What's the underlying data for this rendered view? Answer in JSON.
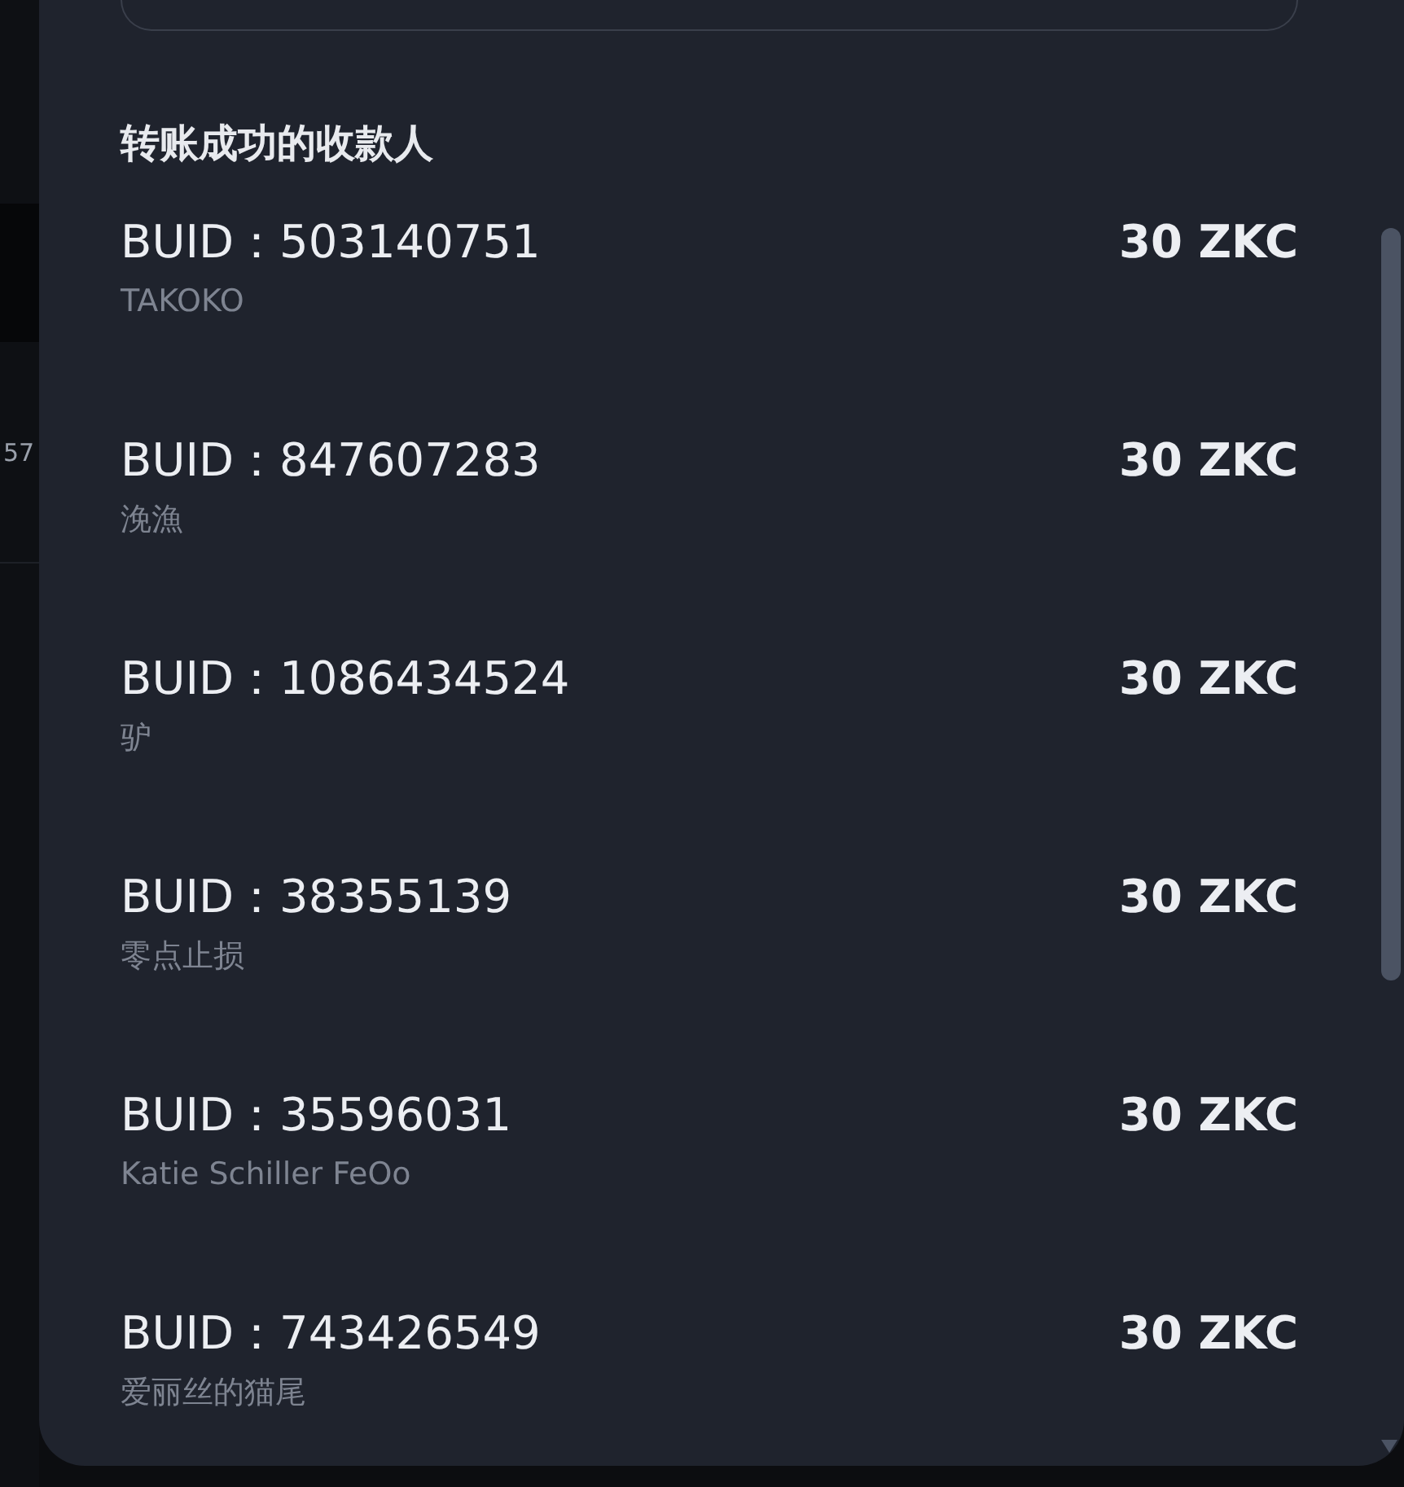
{
  "background_page": {
    "row_value": "57"
  },
  "panel": {
    "title": "转账成功的收款人",
    "recipients": [
      {
        "buid": "BUID：503140751",
        "name": "TAKOKO",
        "amount": "30 ZKC"
      },
      {
        "buid": "BUID：847607283",
        "name": "浼漁",
        "amount": "30 ZKC"
      },
      {
        "buid": "BUID：1086434524",
        "name": "驴",
        "amount": "30 ZKC"
      },
      {
        "buid": "BUID：38355139",
        "name": "零点止损",
        "amount": "30 ZKC"
      },
      {
        "buid": "BUID：35596031",
        "name": "Katie Schiller FeOo",
        "amount": "30 ZKC"
      },
      {
        "buid": "BUID：743426549",
        "name": "爱丽丝的猫尾",
        "amount": "30 ZKC"
      }
    ]
  }
}
